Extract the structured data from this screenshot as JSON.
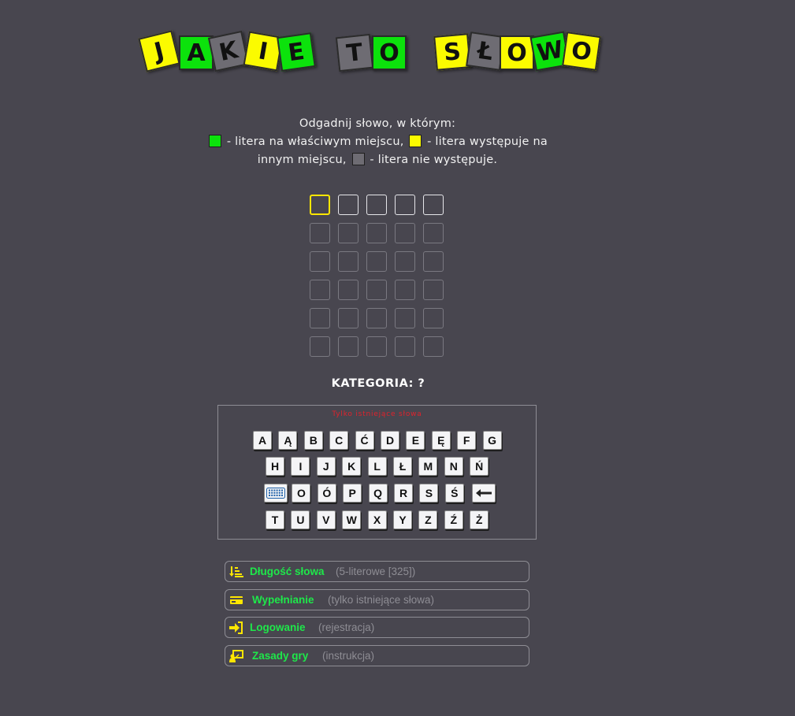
{
  "logo": {
    "words": [
      {
        "text": "JAKIE",
        "letters": [
          {
            "ch": "J",
            "color": "y"
          },
          {
            "ch": "A",
            "color": "g"
          },
          {
            "ch": "K",
            "color": "s"
          },
          {
            "ch": "I",
            "color": "y"
          },
          {
            "ch": "E",
            "color": "g"
          }
        ]
      },
      {
        "text": "TO",
        "letters": [
          {
            "ch": "T",
            "color": "s"
          },
          {
            "ch": "O",
            "color": "g"
          }
        ]
      },
      {
        "text": "SŁOWO",
        "letters": [
          {
            "ch": "S",
            "color": "y"
          },
          {
            "ch": "Ł",
            "color": "s"
          },
          {
            "ch": "O",
            "color": "y"
          },
          {
            "ch": "W",
            "color": "g"
          },
          {
            "ch": "O",
            "color": "y"
          }
        ]
      }
    ]
  },
  "instructions": {
    "line1": "Odgadnij słowo, w którym:",
    "green": "- litera na właściwym miejscu,",
    "yellow": "- litera występuje na",
    "yellow_cont": "innym miejscu,",
    "gray": "- litera nie występuje."
  },
  "grid": {
    "rows": 6,
    "cols": 5
  },
  "category": "KATEGORIA: ?",
  "keyboard": {
    "notice": "Tylko istniejące słowa",
    "rows": [
      [
        "A",
        "Ą",
        "B",
        "C",
        "Ć",
        "D",
        "E",
        "Ę",
        "F",
        "G"
      ],
      [
        "H",
        "I",
        "J",
        "K",
        "L",
        "Ł",
        "M",
        "N",
        "Ń"
      ],
      [
        "keyboard-icon",
        "O",
        "Ó",
        "P",
        "Q",
        "R",
        "S",
        "Ś",
        "backspace-icon"
      ],
      [
        "T",
        "U",
        "V",
        "W",
        "X",
        "Y",
        "Z",
        "Ź",
        "Ż"
      ]
    ]
  },
  "options": [
    {
      "icon": "sort-icon",
      "label": "Długość słowa",
      "sub": "(5-literowe [325])"
    },
    {
      "icon": "card-icon",
      "label": "Wypełnianie",
      "sub": "(tylko istniejące słowa)"
    },
    {
      "icon": "login-icon",
      "label": "Logowanie",
      "sub": "(rejestracja)"
    },
    {
      "icon": "rules-icon",
      "label": "Zasady gry",
      "sub": "(instrukcja)"
    }
  ],
  "colors": {
    "background": "#48464f",
    "tile_yellow": "#fbfb00",
    "tile_green": "#0ce20c",
    "tile_gray": "#6e6c73",
    "cursor": "#ffe600",
    "notice": "#e0222c",
    "option_label": "#1ee84a"
  }
}
